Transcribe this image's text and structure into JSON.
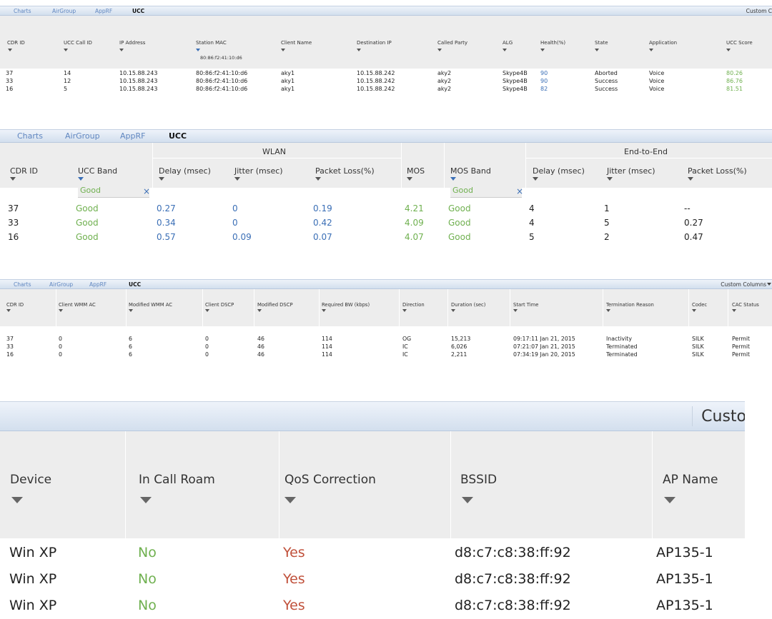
{
  "panel1": {
    "tabs": [
      "Charts",
      "AirGroup",
      "AppRF",
      "UCC"
    ],
    "custom_columns": "Custom C",
    "columns": [
      "CDR ID",
      "UCC Call ID",
      "IP Address",
      "Station MAC",
      "Client Name",
      "Destination IP",
      "Called Party",
      "ALG",
      "Health(%)",
      "State",
      "Application",
      "UCC Score"
    ],
    "station_mac_filter": "80:86:f2:41:10:d6",
    "rows": [
      [
        "37",
        "14",
        "10.15.88.243",
        "80:86:f2:41:10:d6",
        "aky1",
        "10.15.88.242",
        "aky2",
        "Skype4B",
        "90",
        "Aborted",
        "Voice",
        "80.26"
      ],
      [
        "33",
        "12",
        "10.15.88.243",
        "80:86:f2:41:10:d6",
        "aky1",
        "10.15.88.242",
        "aky2",
        "Skype4B",
        "90",
        "Success",
        "Voice",
        "86.76"
      ],
      [
        "16",
        "5",
        "10.15.88.243",
        "80:86:f2:41:10:d6",
        "aky1",
        "10.15.88.242",
        "aky2",
        "Skype4B",
        "82",
        "Success",
        "Voice",
        "81.51"
      ]
    ]
  },
  "panel2": {
    "tabs": [
      "Charts",
      "AirGroup",
      "AppRF",
      "UCC"
    ],
    "groups": {
      "wlan": "WLAN",
      "end_to_end": "End-to-End"
    },
    "columns": [
      "CDR ID",
      "UCC Band",
      "Delay (msec)",
      "Jitter (msec)",
      "Packet Loss(%)",
      "MOS",
      "MOS Band",
      "Delay (msec)",
      "Jitter (msec)",
      "Packet Loss(%)"
    ],
    "ucc_band_filter": "Good",
    "mos_band_filter": "Good",
    "clear_symbol": "×",
    "rows": [
      [
        "37",
        "Good",
        "0.27",
        "0",
        "0.19",
        "4.21",
        "Good",
        "4",
        "1",
        "--"
      ],
      [
        "33",
        "Good",
        "0.34",
        "0",
        "0.42",
        "4.09",
        "Good",
        "4",
        "5",
        "0.27"
      ],
      [
        "16",
        "Good",
        "0.57",
        "0.09",
        "0.07",
        "4.07",
        "Good",
        "5",
        "2",
        "0.47"
      ]
    ]
  },
  "panel3": {
    "tabs": [
      "Charts",
      "AirGroup",
      "AppRF",
      "UCC"
    ],
    "custom_columns": "Custom Columns",
    "columns": [
      "CDR ID",
      "Client WMM AC",
      "Modified WMM AC",
      "Client DSCP",
      "Modified DSCP",
      "Required BW (kbps)",
      "Direction",
      "Duration (sec)",
      "Start Time",
      "Termination Reason",
      "Codec",
      "CAC Status"
    ],
    "rows": [
      [
        "37",
        "0",
        "6",
        "0",
        "46",
        "114",
        "OG",
        "15,213",
        "09:17:11 Jan 21, 2015",
        "Inactivity",
        "SILK",
        "Permit"
      ],
      [
        "33",
        "0",
        "6",
        "0",
        "46",
        "114",
        "IC",
        "6,026",
        "07:21:07 Jan 21, 2015",
        "Terminated",
        "SILK",
        "Permit"
      ],
      [
        "16",
        "0",
        "6",
        "0",
        "46",
        "114",
        "IC",
        "2,211",
        "07:34:19 Jan 20, 2015",
        "Terminated",
        "SILK",
        "Permit"
      ]
    ]
  },
  "panel4": {
    "custom_columns": "Custo",
    "columns": [
      "Device",
      "In Call Roam",
      "QoS Correction",
      "BSSID",
      "AP Name"
    ],
    "rows": [
      [
        "Win XP",
        "No",
        "Yes",
        "d8:c7:c8:38:ff:92",
        "AP135-1"
      ],
      [
        "Win XP",
        "No",
        "Yes",
        "d8:c7:c8:38:ff:92",
        "AP135-1"
      ],
      [
        "Win XP",
        "No",
        "Yes",
        "d8:c7:c8:38:ff:92",
        "AP135-1"
      ]
    ]
  },
  "colors": {
    "good_green": "#6fb04f",
    "link_blue": "#3b6fb6",
    "yes_red": "#c0503a",
    "header_gray": "#ededed",
    "tabbar_blue": "#d3dfee"
  },
  "icons": {
    "filter": "funnel-icon",
    "clear": "close-icon",
    "dropdown": "chevron-down-icon"
  }
}
